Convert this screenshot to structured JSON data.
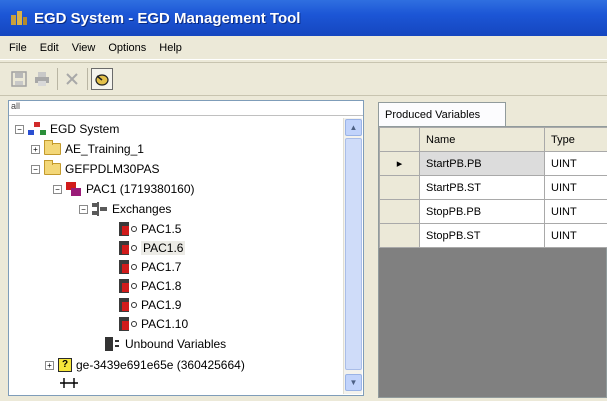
{
  "window": {
    "title": "EGD System - EGD Management Tool"
  },
  "menu": [
    "File",
    "Edit",
    "View",
    "Options",
    "Help"
  ],
  "toolbar": {
    "buttons": [
      "save",
      "print",
      "delete",
      "connect"
    ]
  },
  "left_panel": {
    "header": "all"
  },
  "tree": {
    "root": "EGD System",
    "ae_training": "AE_Training_1",
    "gefpdlm": "GEFPDLM30PAS",
    "pac1": "PAC1 (1719380160)",
    "exchanges": "Exchanges",
    "exchange_items": [
      "PAC1.5",
      "PAC1.6",
      "PAC1.7",
      "PAC1.8",
      "PAC1.9",
      "PAC1.10"
    ],
    "unbound": "Unbound Variables",
    "ge_node": "ge-3439e691e65e (360425664)"
  },
  "right_panel": {
    "tab": "Produced Variables",
    "columns": [
      "Name",
      "Type"
    ],
    "rows": [
      {
        "name": "StartPB.PB",
        "type": "UINT",
        "marker": "▸"
      },
      {
        "name": "StartPB.ST",
        "type": "UINT",
        "marker": ""
      },
      {
        "name": "StopPB.PB",
        "type": "UINT",
        "marker": ""
      },
      {
        "name": "StopPB.ST",
        "type": "UINT",
        "marker": ""
      }
    ]
  },
  "colors": {
    "title_bar": "#1c56d6",
    "tree_red_icon": "#cc1b1b",
    "grid_empty": "#808080"
  },
  "icons": {
    "system": "network-system-icon",
    "folder": "folder-icon",
    "pac": "controller-icon",
    "exchange": "exchange-icon",
    "unknown": "question-icon"
  }
}
